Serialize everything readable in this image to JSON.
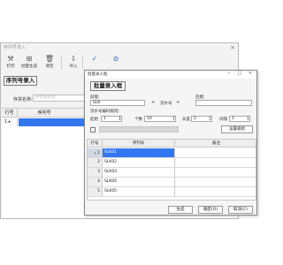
{
  "main": {
    "title": "序列号录入",
    "toolbar": [
      {
        "icon": "tools-icon",
        "label": "打印"
      },
      {
        "icon": "batch-icon",
        "label": "批量生成"
      },
      {
        "icon": "trash-icon",
        "label": "清空"
      },
      {
        "icon": "import-icon",
        "label": "导入"
      },
      {
        "icon": "check-icon",
        "label": ""
      },
      {
        "icon": "cancel-icon",
        "label": ""
      }
    ],
    "section_title": "序列号录入",
    "template_label": "存货名称:",
    "template_placeholder": "序列号存货",
    "grid": {
      "col_rowno": "行号",
      "col_serial": "序列号",
      "rows": [
        {
          "no": "1"
        }
      ]
    }
  },
  "dialog": {
    "title": "批量录入框",
    "header": "批量录入框",
    "prefix_label": "前缀:",
    "prefix_value": "SLK",
    "serial_label": "流水号",
    "suffix_label": "后缀:",
    "serial_rule_label": "流水号编码规则:",
    "start_label": "起始",
    "start_value": "1",
    "count_label": "个数",
    "count_value": "10",
    "length_label": "长度",
    "length_value": "2",
    "step_label": "间隔",
    "step_value": "1",
    "set_rule_button": "设置规则",
    "grid": {
      "col_rowno": "行号",
      "col_serial": "序列号",
      "col_note": "备注",
      "rows": [
        {
          "no": "1",
          "serial": "SLK01"
        },
        {
          "no": "2",
          "serial": "SLK02"
        },
        {
          "no": "3",
          "serial": "SLK03"
        },
        {
          "no": "4",
          "serial": "SLK04"
        },
        {
          "no": "5",
          "serial": "SLK05"
        }
      ]
    },
    "generate_button": "生成",
    "ok_button": "确定(O)",
    "cancel_button": "取消(C)"
  }
}
